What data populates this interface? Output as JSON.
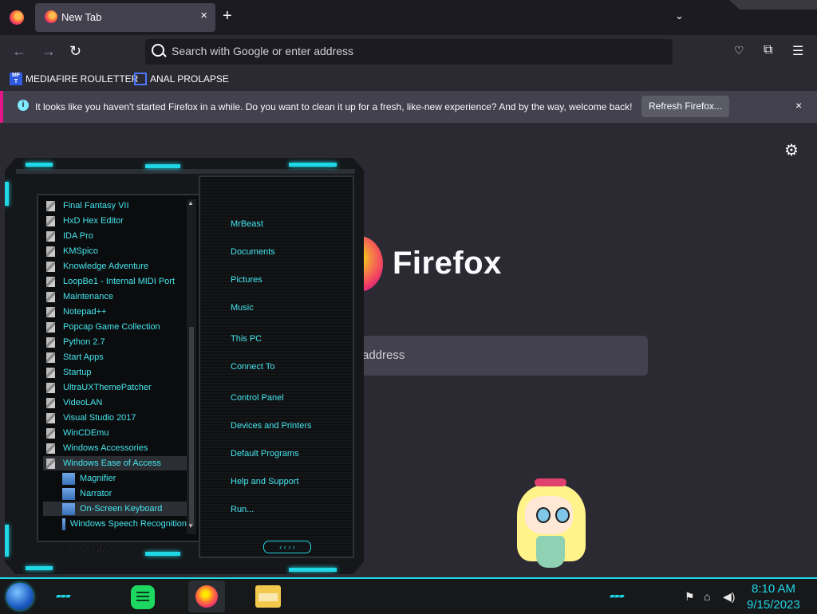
{
  "tab": {
    "title": "New Tab",
    "close_icon": "×",
    "new_tab_icon": "+",
    "list_icon": "⌄"
  },
  "nav": {
    "back_icon": "←",
    "forward_icon": "→",
    "reload_icon": "↻",
    "url_placeholder": "Search with Google or enter address",
    "pocket_icon": "♡",
    "extensions_icon": "⧉",
    "menu_icon": "☰"
  },
  "bookmarks": [
    {
      "label": "MEDIAFIRE ROULETTER",
      "icon_text": "MF T"
    },
    {
      "label": "ANAL PROLAPSE",
      "icon_text": ""
    }
  ],
  "notice": {
    "info_icon": "i",
    "text": "It looks like you haven't started Firefox in a while. Do you want to clean it up for a fresh, like-new experience? And by the way, welcome back!",
    "button": "Refresh Firefox...",
    "close_icon": "×"
  },
  "newtab": {
    "settings_icon": "⚙",
    "wordmark": "Firefox",
    "search_placeholder_visible": "address"
  },
  "startmenu": {
    "programs": [
      "Final Fantasy VII",
      "HxD Hex Editor",
      "IDA Pro",
      "KMSpico",
      "Knowledge Adventure",
      "LoopBe1 - Internal MIDI Port",
      "Maintenance",
      "Notepad++",
      "Popcap Game Collection",
      "Python 2.7",
      "Start Apps",
      "Startup",
      "UltraUXThemePatcher",
      "VideoLAN",
      "Visual Studio 2017",
      "WinCDEmu",
      "Windows Accessories",
      "Windows Ease of Access",
      "Magnifier",
      "Narrator",
      "On-Screen Keyboard",
      "Windows Speech Recognition"
    ],
    "places": [
      "MrBeast",
      "Documents",
      "Pictures",
      "Music",
      "This PC",
      "Connect To",
      "Control Panel",
      "Devices and Printers",
      "Default Programs",
      "Help and Support",
      "Run..."
    ],
    "system_label": "SYSTEM",
    "nav_arrows": "‹ ‹ › ›",
    "scroll_up": "▲",
    "scroll_down": "▼"
  },
  "taskbar": {
    "dashes": "▰▰▰",
    "tray_flag_icon": "⚑",
    "tray_network_icon": "⌂",
    "tray_volume_icon": "◀)",
    "time": "8:10 AM",
    "date": "9/15/2023"
  },
  "colors": {
    "accent_cyan": "#1fd7e6",
    "firefox_bg": "#2b2a33",
    "notice_stripe": "#e31587"
  }
}
